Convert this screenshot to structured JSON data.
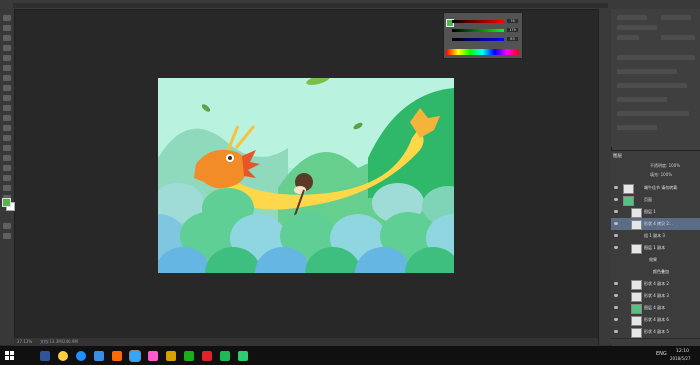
{
  "app": {
    "name": "Photoshop"
  },
  "color_panel": {
    "foreground": "#58b34e",
    "background": "#ffffff",
    "r": "76",
    "g": "179",
    "b": "83"
  },
  "status": {
    "zoom": "27.13%",
    "doc": "文档:13.3M/246.9M"
  },
  "layers_panel": {
    "tab": "图层",
    "opacity_label": "不透明度: 100%",
    "fill_label": "填充: 100%",
    "rows": [
      {
        "label": "端午佳节 请勿转载",
        "selected": false
      },
      {
        "label": "页面",
        "selected": false
      },
      {
        "label": "图层 1",
        "selected": false
      },
      {
        "label": "形状 4 拷贝 2...",
        "selected": true
      },
      {
        "label": "组 1 副本 3",
        "selected": false
      },
      {
        "label": "图层 1 副本",
        "selected": false
      },
      {
        "label": "效果",
        "selected": false
      },
      {
        "label": "颜色叠加",
        "selected": false
      },
      {
        "label": "形状 4 副本 2",
        "selected": false
      },
      {
        "label": "形状 4 副本 3",
        "selected": false
      },
      {
        "label": "图层 4 副本",
        "selected": false
      },
      {
        "label": "形状 4 副本 6",
        "selected": false
      },
      {
        "label": "形状 4 副本 5",
        "selected": false
      }
    ]
  },
  "taskbar": {
    "lang": "ENG",
    "time": "12:10",
    "date": "2018/5/27",
    "icon_colors": [
      "#2f5597",
      "#ffcf3f",
      "#1e90ff",
      "#3a8ee6",
      "#ff6a00",
      "#31a8ff",
      "#ff5bcf",
      "#d6a100",
      "#1aad19",
      "#e22129",
      "#1db954",
      "#2ecc71"
    ]
  }
}
